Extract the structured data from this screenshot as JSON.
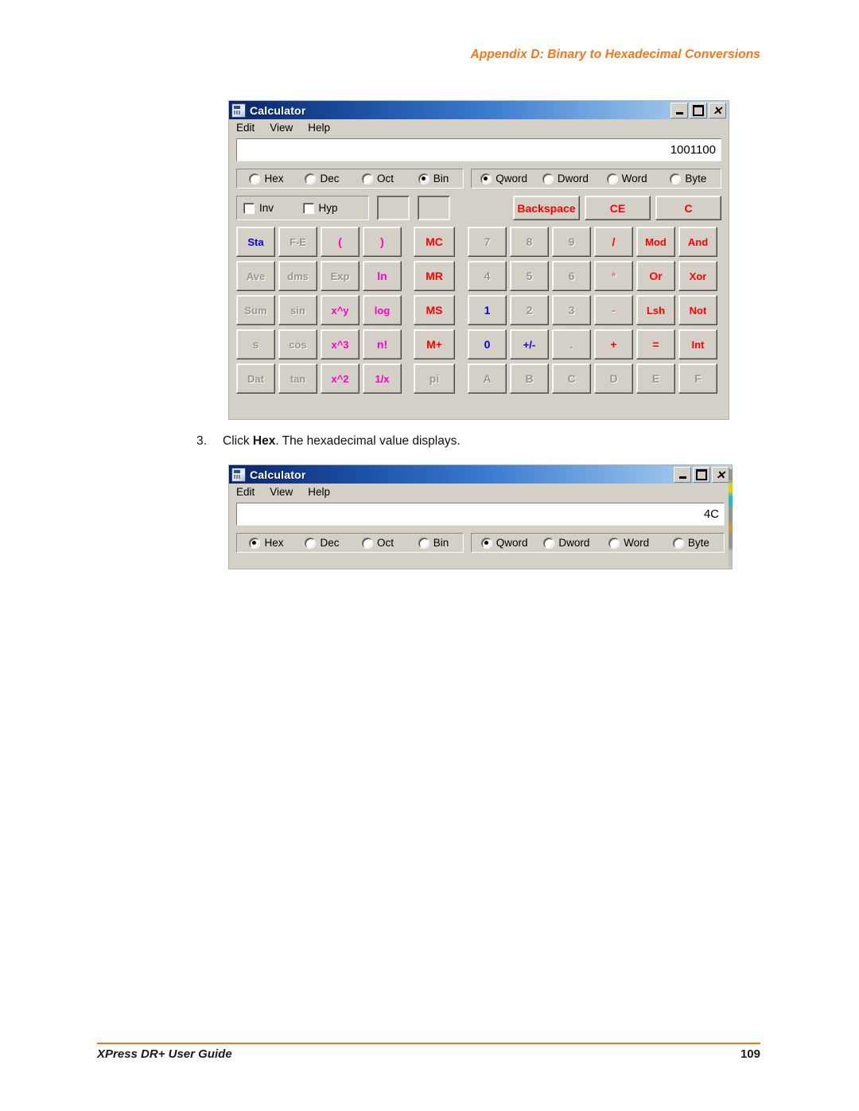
{
  "page": {
    "header": "Appendix D: Binary to Hexadecimal Conversions",
    "footer_left": "XPress DR+ User Guide",
    "footer_page": "109",
    "accent_color": "#F5761A"
  },
  "step": {
    "number": "3.",
    "text_before": "Click ",
    "bold": "Hex",
    "text_after": ". The hexadecimal value displays."
  },
  "calc_bin": {
    "title": "Calculator",
    "icon": "calculator-icon",
    "window_buttons": {
      "minimize": "minimize-icon",
      "maximize": "maximize-icon",
      "close": "close-icon"
    },
    "menu": [
      "Edit",
      "View",
      "Help"
    ],
    "display_value": "1001100",
    "base_group": {
      "options": [
        "Hex",
        "Dec",
        "Oct",
        "Bin"
      ],
      "selected": "Bin"
    },
    "word_group": {
      "options": [
        "Qword",
        "Dword",
        "Word",
        "Byte"
      ],
      "selected": "Qword"
    },
    "modifiers": [
      {
        "label": "Inv",
        "checked": false
      },
      {
        "label": "Hyp",
        "checked": false
      }
    ],
    "blank_boxes": 2,
    "edit_buttons": [
      {
        "label": "Backspace",
        "color": "#FF0000"
      },
      {
        "label": "CE",
        "color": "#FF0000"
      },
      {
        "label": "C",
        "color": "#FF0000"
      }
    ],
    "left_keys": [
      {
        "label": "Sta",
        "color": "#0000E0",
        "enabled": true
      },
      {
        "label": "F-E",
        "color": "#9a968f",
        "enabled": false
      },
      {
        "label": "(",
        "color": "#FF00C8",
        "enabled": true
      },
      {
        "label": ")",
        "color": "#FF00C8",
        "enabled": true
      },
      {
        "label": "Ave",
        "color": "#9a968f",
        "enabled": false
      },
      {
        "label": "dms",
        "color": "#9a968f",
        "enabled": false
      },
      {
        "label": "Exp",
        "color": "#9a968f",
        "enabled": false
      },
      {
        "label": "ln",
        "color": "#FF00C8",
        "enabled": true
      },
      {
        "label": "Sum",
        "color": "#9a968f",
        "enabled": false
      },
      {
        "label": "sin",
        "color": "#9a968f",
        "enabled": false
      },
      {
        "label": "x^y",
        "color": "#FF00C8",
        "enabled": true
      },
      {
        "label": "log",
        "color": "#FF00C8",
        "enabled": true
      },
      {
        "label": "s",
        "color": "#9a968f",
        "enabled": false
      },
      {
        "label": "cos",
        "color": "#9a968f",
        "enabled": false
      },
      {
        "label": "x^3",
        "color": "#FF00C8",
        "enabled": true
      },
      {
        "label": "n!",
        "color": "#FF00C8",
        "enabled": true
      },
      {
        "label": "Dat",
        "color": "#9a968f",
        "enabled": false
      },
      {
        "label": "tan",
        "color": "#9a968f",
        "enabled": false
      },
      {
        "label": "x^2",
        "color": "#FF00C8",
        "enabled": true
      },
      {
        "label": "1/x",
        "color": "#FF00C8",
        "enabled": true
      }
    ],
    "memory_keys": [
      {
        "label": "MC",
        "color": "#FF0000",
        "enabled": true
      },
      {
        "label": "MR",
        "color": "#FF0000",
        "enabled": true
      },
      {
        "label": "MS",
        "color": "#FF0000",
        "enabled": true
      },
      {
        "label": "M+",
        "color": "#FF0000",
        "enabled": true
      },
      {
        "label": "pi",
        "color": "#9a968f",
        "enabled": false
      }
    ],
    "number_keys": [
      {
        "label": "7",
        "color": "#9a968f",
        "enabled": false
      },
      {
        "label": "8",
        "color": "#9a968f",
        "enabled": false
      },
      {
        "label": "9",
        "color": "#9a968f",
        "enabled": false
      },
      {
        "label": "/",
        "color": "#FF0000",
        "enabled": true
      },
      {
        "label": "Mod",
        "color": "#FF0000",
        "enabled": true
      },
      {
        "label": "And",
        "color": "#FF0000",
        "enabled": true
      },
      {
        "label": "4",
        "color": "#9a968f",
        "enabled": false
      },
      {
        "label": "5",
        "color": "#9a968f",
        "enabled": false
      },
      {
        "label": "6",
        "color": "#9a968f",
        "enabled": false
      },
      {
        "label": "*",
        "color": "#c08080",
        "enabled": false
      },
      {
        "label": "Or",
        "color": "#FF0000",
        "enabled": true
      },
      {
        "label": "Xor",
        "color": "#FF0000",
        "enabled": true
      },
      {
        "label": "1",
        "color": "#0000E0",
        "enabled": true
      },
      {
        "label": "2",
        "color": "#9a968f",
        "enabled": false
      },
      {
        "label": "3",
        "color": "#9a968f",
        "enabled": false
      },
      {
        "label": "-",
        "color": "#c08080",
        "enabled": false
      },
      {
        "label": "Lsh",
        "color": "#FF0000",
        "enabled": true
      },
      {
        "label": "Not",
        "color": "#FF0000",
        "enabled": true
      },
      {
        "label": "0",
        "color": "#0000E0",
        "enabled": true
      },
      {
        "label": "+/-",
        "color": "#0000E0",
        "enabled": true
      },
      {
        "label": ".",
        "color": "#9a968f",
        "enabled": false
      },
      {
        "label": "+",
        "color": "#FF0000",
        "enabled": true
      },
      {
        "label": "=",
        "color": "#FF0000",
        "enabled": true
      },
      {
        "label": "Int",
        "color": "#FF0000",
        "enabled": true
      },
      {
        "label": "A",
        "color": "#9a968f",
        "enabled": false
      },
      {
        "label": "B",
        "color": "#9a968f",
        "enabled": false
      },
      {
        "label": "C",
        "color": "#9a968f",
        "enabled": false
      },
      {
        "label": "D",
        "color": "#9a968f",
        "enabled": false
      },
      {
        "label": "E",
        "color": "#9a968f",
        "enabled": false
      },
      {
        "label": "F",
        "color": "#9a968f",
        "enabled": false
      }
    ]
  },
  "calc_hex": {
    "title": "Calculator",
    "icon": "calculator-icon",
    "window_buttons": {
      "minimize": "minimize-icon",
      "maximize": "maximize-icon",
      "close": "close-icon"
    },
    "menu": [
      "Edit",
      "View",
      "Help"
    ],
    "display_value": "4C",
    "base_group": {
      "options": [
        "Hex",
        "Dec",
        "Oct",
        "Bin"
      ],
      "selected": "Hex"
    },
    "word_group": {
      "options": [
        "Qword",
        "Dword",
        "Word",
        "Byte"
      ],
      "selected": "Qword"
    }
  }
}
